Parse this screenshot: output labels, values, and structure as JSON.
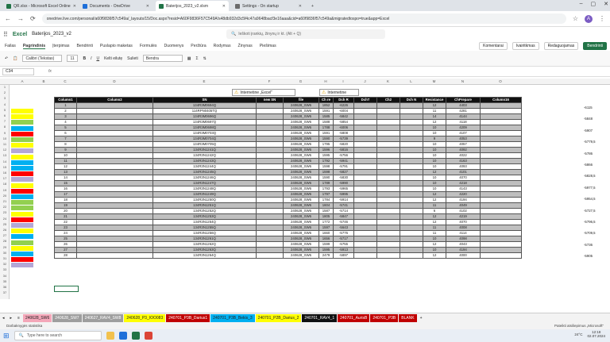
{
  "browser": {
    "tabs": [
      {
        "label": "QR.xlsx - Microsoft Excel Online",
        "color": "#217346"
      },
      {
        "label": "Documents - OneDrive",
        "color": "#1e6fd9"
      },
      {
        "label": "Baterijos_2023_v2.xlsm",
        "color": "#217346"
      },
      {
        "label": "Settings - On startup",
        "color": "#6b6b6b"
      }
    ],
    "url": "onedrive.live.com/personal/a60f9836f57c549a/_layouts/15/Doc.aspx?resid=A60F9836F57C549A!s48db932d3c5f4c47a9648bacf3e16aaa&cid=a60f9836f57c549a&migratedtospo=true&app=Excel",
    "avatar": "A"
  },
  "excel": {
    "app": "Excel",
    "file": "Baterijos_2023_v2",
    "search_placeholder": "Ieškoti įrankių, žinynų ir kt. (Alt + Q)",
    "menu": [
      "Failas",
      "Pagrindinis",
      "Įterpimas",
      "Bendrinti",
      "Puslapio maketas",
      "Formulės",
      "Duomenys",
      "Peržiūra",
      "Rodymas",
      "Žinynas",
      "Piešimas"
    ],
    "right_menu": [
      "Komentarai",
      "Ivairitkmas",
      "Redaguojamas",
      "Bendrinti"
    ],
    "ribbon": {
      "font": "Calibri (Tekstas)",
      "size": "11",
      "wrap": "Kelti eilutę",
      "merge": "Sulieti",
      "format": "Bendra"
    },
    "namebox": "C34",
    "fx": "fx"
  },
  "columns": [
    "A",
    "B",
    "C",
    "D",
    "E",
    "F",
    "G",
    "H",
    "I",
    "J",
    "K",
    "L",
    "M",
    "N",
    "O"
  ],
  "warnings": [
    "Internetine „Excel“",
    "Internetine"
  ],
  "table": {
    "headers": [
      "Column1",
      "Column2",
      "SN",
      "new SN",
      "file",
      "Ch re",
      "Dch R",
      "DchT",
      "Ch2",
      "Dch N",
      "Resistance",
      "ChPrepare",
      "Column16"
    ],
    "rows": [
      [
        "1",
        "",
        "134R3M0694Q",
        "",
        "240628_SW6",
        "1852",
        "-6226",
        "",
        "",
        "",
        "12",
        "4403",
        ""
      ],
      [
        "2",
        "",
        "114RPN0405TQ",
        "",
        "240628_SW6",
        "1591",
        "-6004",
        "",
        "",
        "",
        "11",
        "4281",
        ""
      ],
      [
        "3",
        "",
        "134R3M0696Q",
        "",
        "240628_SW6",
        "1585",
        "-5842",
        "",
        "",
        "",
        "14",
        "4144",
        ""
      ],
      [
        "4",
        "",
        "134R3M0697Q",
        "",
        "240628_SW6",
        "1588",
        "-5854",
        "",
        "",
        "",
        "12",
        "4118",
        ""
      ],
      [
        "5",
        "",
        "134R3M0698Q",
        "",
        "240628_SW6",
        "1788",
        "-6006",
        "",
        "",
        "",
        "10",
        "4209",
        ""
      ],
      [
        "6",
        "",
        "134R3M0703Q",
        "",
        "240628_SW6",
        "1591",
        "-5808",
        "",
        "",
        "",
        "10",
        "4107",
        ""
      ],
      [
        "7",
        "",
        "134R3M0704Q",
        "",
        "240628_SW6",
        "1590",
        "-5739",
        "",
        "",
        "",
        "9",
        "4053",
        ""
      ],
      [
        "8",
        "",
        "134R3M0705Q",
        "",
        "240628_SW6",
        "1795",
        "-5820",
        "",
        "",
        "",
        "10",
        "4057",
        ""
      ],
      [
        "9",
        "",
        "134R3N1241Q",
        "",
        "240628_SW6",
        "1596",
        "-5816",
        "",
        "",
        "",
        "10",
        "4092",
        ""
      ],
      [
        "10",
        "",
        "134R3N1242Q",
        "",
        "240628_SW6",
        "1595",
        "-5756",
        "",
        "",
        "",
        "10",
        "4022",
        ""
      ],
      [
        "11",
        "",
        "134R3N1243Q",
        "",
        "240628_SW6",
        "1792",
        "-5941",
        "",
        "",
        "",
        "10",
        "4163",
        ""
      ],
      [
        "12",
        "",
        "134R3N1244Q",
        "",
        "240628_SW6",
        "1598",
        "-5791",
        "",
        "",
        "",
        "10",
        "4093",
        ""
      ],
      [
        "13",
        "",
        "134R3N1245Q",
        "",
        "240628_SW6",
        "1598",
        "-5827",
        "",
        "",
        "",
        "12",
        "4101",
        ""
      ],
      [
        "14",
        "",
        "134R3N1246Q",
        "",
        "240628_SW6",
        "1590",
        "-5830",
        "",
        "",
        "",
        "10",
        "4070",
        ""
      ],
      [
        "15",
        "",
        "134R3N1247Q",
        "",
        "240628_SW6",
        "1789",
        "-5990",
        "",
        "",
        "",
        "10",
        "4218",
        ""
      ],
      [
        "16",
        "",
        "134R3N1248Q",
        "",
        "240628_SW6",
        "1793",
        "-5965",
        "",
        "",
        "",
        "10",
        "4143",
        ""
      ],
      [
        "17",
        "",
        "134R3N1249Q",
        "",
        "240628_SW6",
        "1797",
        "-5995",
        "",
        "",
        "",
        "12",
        "4220",
        ""
      ],
      [
        "18",
        "",
        "134R3N1250Q",
        "",
        "240628_SW6",
        "1784",
        "-5914",
        "",
        "",
        "",
        "12",
        "4194",
        ""
      ],
      [
        "19",
        "",
        "134R3N1251Q",
        "",
        "240628_SW6",
        "1604",
        "-5741",
        "",
        "",
        "",
        "11",
        "4049",
        ""
      ],
      [
        "20",
        "",
        "134R3N1252Q",
        "",
        "240628_SW6",
        "1587",
        "-5714",
        "",
        "",
        "",
        "6",
        "4102",
        ""
      ],
      [
        "21",
        "",
        "134R3N1253Q",
        "",
        "240628_SW6",
        "1805",
        "-5847",
        "",
        "",
        "",
        "12",
        "4219",
        ""
      ],
      [
        "22",
        "",
        "134R3N1254Q",
        "",
        "240628_SW6",
        "1772",
        "-5746",
        "",
        "",
        "",
        "12",
        "4070",
        ""
      ],
      [
        "23",
        "",
        "134R3N1255Q",
        "",
        "240628_SW6",
        "1597",
        "-5643",
        "",
        "",
        "",
        "11",
        "4008",
        ""
      ],
      [
        "24",
        "",
        "134R3N1256Q",
        "",
        "240628_SW6",
        "1660",
        "-5776",
        "",
        "",
        "",
        "11",
        "4114",
        ""
      ],
      [
        "25",
        "",
        "134R3N1261Q",
        "",
        "240628_SW6",
        "1656",
        "-5717",
        "",
        "",
        "",
        "10",
        "4098",
        ""
      ],
      [
        "26",
        "",
        "134R3N1262Q",
        "",
        "240628_SW6",
        "1599",
        "-5755",
        "",
        "",
        "",
        "12",
        "4043",
        ""
      ],
      [
        "27",
        "",
        "134R3N1263Q",
        "",
        "240628_SW6",
        "1595",
        "-5913",
        "",
        "",
        "",
        "10",
        "4194",
        ""
      ],
      [
        "28",
        "",
        "134R3N1264Q",
        "",
        "240628_SW6",
        "2479",
        "-5897",
        "",
        "",
        "",
        "12",
        "4000",
        ""
      ]
    ]
  },
  "right_values": [
    "-6115",
    "-5848",
    "-5907",
    "-5779,5",
    "-5786",
    "-5866",
    "-5828,5",
    "-5977,5",
    "-5954,5",
    "-5727,5",
    "-5796,5",
    "-5709,5",
    "-5736",
    "-5905"
  ],
  "swatches": [
    "#ffff00",
    "#ffff00",
    "#92d050",
    "#00b0f0",
    "#ff0000",
    "#92d050",
    "#ffff00",
    "#b4a7d6",
    "#ffff00",
    "#00b0f0",
    "#00b0f0",
    "#ff0000",
    "#b4a7d6",
    "#ffff00",
    "#ff0000",
    "#00b0f0",
    "#92d050",
    "#92d050",
    "#ffff00",
    "#ff0000",
    "#b4a7d6",
    "#ffff00",
    "#00b0f0",
    "#92d050",
    "#ffff00",
    "#00b0f0",
    "#ff0000",
    "#b4a7d6"
  ],
  "sheets": [
    {
      "label": "240628_SW6",
      "bg": "#f4a7b9",
      "fg": "#222"
    },
    {
      "label": "240628_SW7",
      "bg": "#9e9e9e",
      "fg": "#fff"
    },
    {
      "label": "240627_RAV4_SW8",
      "bg": "#9e9e9e",
      "fg": "#fff"
    },
    {
      "label": "240628_P3_IOO083",
      "bg": "#ffff00",
      "fg": "#222"
    },
    {
      "label": "240701_P3B_Darius1",
      "bg": "#c00000",
      "fg": "#fff"
    },
    {
      "label": "240701_P3B_Bekis_3",
      "bg": "#00b0f0",
      "fg": "#222"
    },
    {
      "label": "240701_P2B_Darius_2",
      "bg": "#ffff00",
      "fg": "#222"
    },
    {
      "label": "240701_RAV4_1",
      "bg": "#111111",
      "fg": "#fff"
    },
    {
      "label": "240701_AurisB",
      "bg": "#c00000",
      "fg": "#fff"
    },
    {
      "label": "240701_P3B",
      "bg": "#c00000",
      "fg": "#fff"
    },
    {
      "label": "BLANK",
      "bg": "#c00000",
      "fg": "#fff"
    }
  ],
  "status": {
    "left": "Darbaknygės statistika",
    "right": "Pateikti atsiliepimus „Microsoft“"
  },
  "taskbar": {
    "search": "Type here to search",
    "weather": "24°C",
    "time": "12:18",
    "date": "02.07.2024"
  }
}
